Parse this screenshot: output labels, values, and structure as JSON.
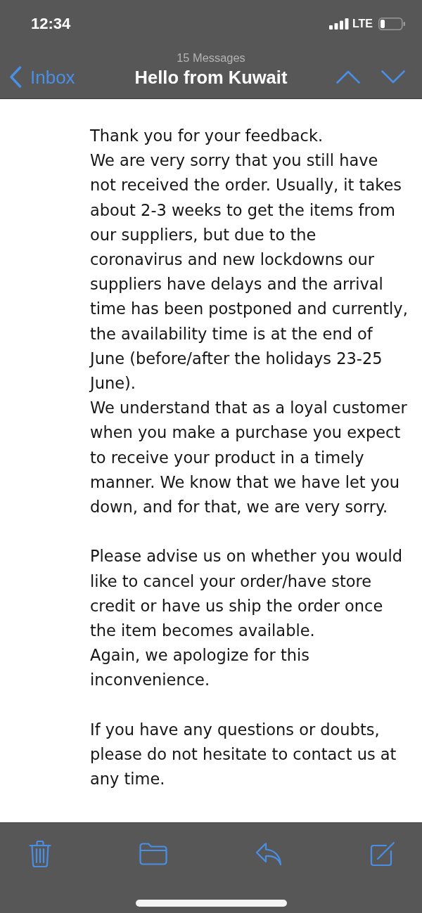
{
  "status_bar": {
    "time": "12:34",
    "network": "LTE"
  },
  "nav_bar": {
    "back_label": "Inbox",
    "message_count": "15 Messages",
    "title": "Hello from Kuwait"
  },
  "message": {
    "blocks": [
      [
        "Thank you for your feedback.",
        "We are very sorry that you still have not received the order. Usually, it takes about 2-3 weeks to get the items from our suppliers, but due to the coronavirus and new lockdowns our suppliers have delays and the arrival time has been postponed and currently, the availability time is at the end of June (before/after the holidays 23-25 June).",
        "We understand that as a loyal customer when you make a purchase you expect to receive your product in a timely manner. We know that we have let you down, and for that, we are very sorry."
      ],
      [
        "Please advise us on whether you would like to cancel your order/have store credit or have us ship the order once the item becomes available.",
        "Again, we apologize for this inconvenience."
      ],
      [
        "If you have any questions or doubts, please do not hesitate to contact us at any time."
      ]
    ]
  }
}
